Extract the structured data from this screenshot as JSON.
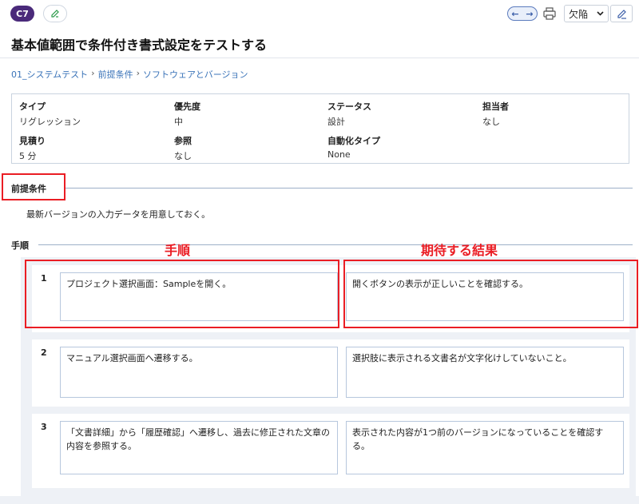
{
  "header": {
    "id_badge": "C7",
    "defect_label": "欠陥",
    "colors": {
      "badge": "#4a2a7a",
      "accent": "#3a73b8",
      "annotation_red": "#ea1d24"
    }
  },
  "title": "基本値範囲で条件付き書式設定をテストする",
  "breadcrumb": [
    "01_システムテスト",
    "前提条件",
    "ソフトウェアとバージョン"
  ],
  "breadcrumb_separator": "›",
  "info": {
    "type_label": "タイプ",
    "type_value": "リグレッション",
    "priority_label": "優先度",
    "priority_value": "中",
    "status_label": "ステータス",
    "status_value": "設計",
    "assignee_label": "担当者",
    "assignee_value": "なし",
    "estimate_label": "見積り",
    "estimate_value": "5 分",
    "reference_label": "参照",
    "reference_value": "なし",
    "automation_label": "自動化タイプ",
    "automation_value": "None"
  },
  "precondition": {
    "heading": "前提条件",
    "text": "最新バージョンの入力データを用意しておく。"
  },
  "steps": {
    "heading": "手順",
    "annotation_steps": "手順",
    "annotation_expected": "期待する結果",
    "items": [
      {
        "num": "1",
        "action": "プロジェクト選択画面：Sampleを開く。",
        "expected": "開くボタンの表示が正しいことを確認する。"
      },
      {
        "num": "2",
        "action": "マニュアル選択画面へ遷移する。",
        "expected": "選択肢に表示される文書名が文字化けしていないこと。"
      },
      {
        "num": "3",
        "action": "「文書詳細」から「履歴確認」へ遷移し、過去に修正された文章の内容を参照する。",
        "expected": "表示された内容が1つ前のバージョンになっていることを確認する。"
      }
    ]
  }
}
